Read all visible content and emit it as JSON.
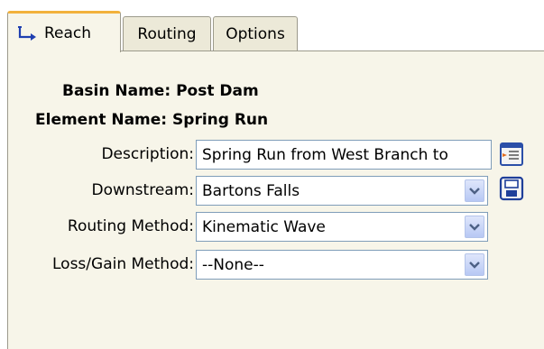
{
  "tabs": [
    {
      "label": "Reach",
      "icon": "reach-icon",
      "active": true
    },
    {
      "label": "Routing",
      "active": false
    },
    {
      "label": "Options",
      "active": false
    }
  ],
  "basin": {
    "label": "Basin Name:",
    "value": "Post Dam"
  },
  "element": {
    "label": "Element Name:",
    "value": "Spring Run"
  },
  "description": {
    "label": "Description:",
    "value": "Spring Run from West Branch to"
  },
  "downstream": {
    "label": "Downstream:",
    "value": "Bartons Falls"
  },
  "routing_method": {
    "label": "Routing Method:",
    "value": "Kinematic Wave"
  },
  "loss_gain_method": {
    "label": "Loss/Gain Method:",
    "value": "--None--"
  },
  "colors": {
    "active_tab_accent": "#f2b13c",
    "panel_bg": "#f7f5e9",
    "dropdown_arrow": "#4d6185"
  }
}
